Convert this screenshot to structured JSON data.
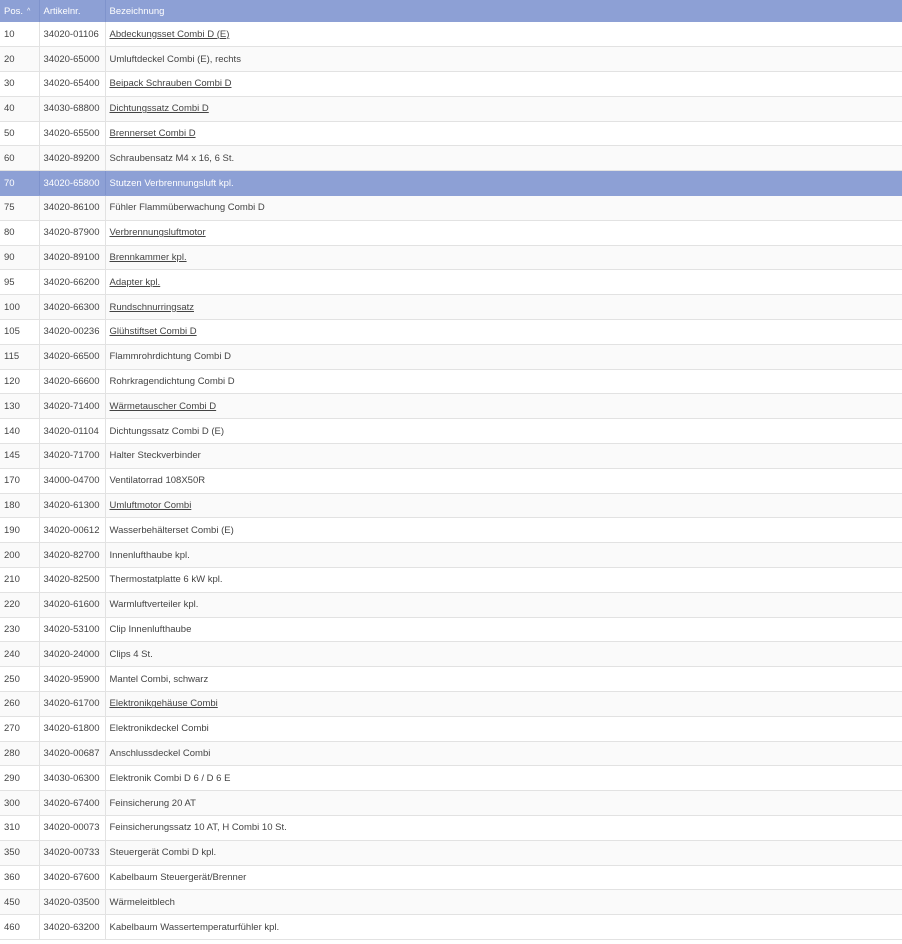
{
  "table": {
    "columns": {
      "pos": "Pos.",
      "artikelnr": "Artikelnr.",
      "bezeichnung": "Bezeichnung"
    },
    "sort_indicator": "^",
    "selected_pos": "70",
    "rows": [
      {
        "pos": "10",
        "artikelnr": "34020-01106",
        "bezeichnung": "Abdeckungsset Combi D (E)",
        "link": true
      },
      {
        "pos": "20",
        "artikelnr": "34020-65000",
        "bezeichnung": "Umluftdeckel Combi (E), rechts",
        "link": false
      },
      {
        "pos": "30",
        "artikelnr": "34020-65400",
        "bezeichnung": "Beipack Schrauben Combi D",
        "link": true
      },
      {
        "pos": "40",
        "artikelnr": "34030-68800",
        "bezeichnung": "Dichtungssatz Combi D",
        "link": true
      },
      {
        "pos": "50",
        "artikelnr": "34020-65500",
        "bezeichnung": "Brennerset Combi D",
        "link": true
      },
      {
        "pos": "60",
        "artikelnr": "34020-89200",
        "bezeichnung": "Schraubensatz M4 x 16, 6 St.",
        "link": false
      },
      {
        "pos": "70",
        "artikelnr": "34020-65800",
        "bezeichnung": "Stutzen Verbrennungsluft kpl.",
        "link": false
      },
      {
        "pos": "75",
        "artikelnr": "34020-86100",
        "bezeichnung": "Fühler Flammüberwachung Combi D",
        "link": false
      },
      {
        "pos": "80",
        "artikelnr": "34020-87900",
        "bezeichnung": "Verbrennungsluftmotor",
        "link": true
      },
      {
        "pos": "90",
        "artikelnr": "34020-89100",
        "bezeichnung": "Brennkammer kpl.",
        "link": true
      },
      {
        "pos": "95",
        "artikelnr": "34020-66200",
        "bezeichnung": "Adapter kpl.",
        "link": true
      },
      {
        "pos": "100",
        "artikelnr": "34020-66300",
        "bezeichnung": "Rundschnurringsatz",
        "link": true
      },
      {
        "pos": "105",
        "artikelnr": "34020-00236",
        "bezeichnung": "Glühstiftset Combi D",
        "link": true
      },
      {
        "pos": "115",
        "artikelnr": "34020-66500",
        "bezeichnung": "Flammrohrdichtung Combi D",
        "link": false
      },
      {
        "pos": "120",
        "artikelnr": "34020-66600",
        "bezeichnung": "Rohrkragendichtung Combi D",
        "link": false
      },
      {
        "pos": "130",
        "artikelnr": "34020-71400",
        "bezeichnung": "Wärmetauscher Combi D",
        "link": true
      },
      {
        "pos": "140",
        "artikelnr": "34020-01104",
        "bezeichnung": "Dichtungssatz Combi D (E)",
        "link": false
      },
      {
        "pos": "145",
        "artikelnr": "34020-71700",
        "bezeichnung": "Halter Steckverbinder",
        "link": false
      },
      {
        "pos": "170",
        "artikelnr": "34000-04700",
        "bezeichnung": "Ventilatorrad 108X50R",
        "link": false
      },
      {
        "pos": "180",
        "artikelnr": "34020-61300",
        "bezeichnung": "Umluftmotor Combi",
        "link": true
      },
      {
        "pos": "190",
        "artikelnr": "34020-00612",
        "bezeichnung": "Wasserbehälterset Combi (E)",
        "link": false
      },
      {
        "pos": "200",
        "artikelnr": "34020-82700",
        "bezeichnung": "Innenlufthaube kpl.",
        "link": false
      },
      {
        "pos": "210",
        "artikelnr": "34020-82500",
        "bezeichnung": "Thermostatplatte 6 kW kpl.",
        "link": false
      },
      {
        "pos": "220",
        "artikelnr": "34020-61600",
        "bezeichnung": "Warmluftverteiler kpl.",
        "link": false
      },
      {
        "pos": "230",
        "artikelnr": "34020-53100",
        "bezeichnung": "Clip Innenlufthaube",
        "link": false
      },
      {
        "pos": "240",
        "artikelnr": "34020-24000",
        "bezeichnung": "Clips 4 St.",
        "link": false
      },
      {
        "pos": "250",
        "artikelnr": "34020-95900",
        "bezeichnung": "Mantel Combi, schwarz",
        "link": false
      },
      {
        "pos": "260",
        "artikelnr": "34020-61700",
        "bezeichnung": "Elektronikgehäuse Combi",
        "link": true
      },
      {
        "pos": "270",
        "artikelnr": "34020-61800",
        "bezeichnung": "Elektronikdeckel Combi",
        "link": false
      },
      {
        "pos": "280",
        "artikelnr": "34020-00687",
        "bezeichnung": "Anschlussdeckel Combi",
        "link": false
      },
      {
        "pos": "290",
        "artikelnr": "34030-06300",
        "bezeichnung": "Elektronik Combi D 6 / D 6 E",
        "link": false
      },
      {
        "pos": "300",
        "artikelnr": "34020-67400",
        "bezeichnung": "Feinsicherung 20 AT",
        "link": false
      },
      {
        "pos": "310",
        "artikelnr": "34020-00073",
        "bezeichnung": "Feinsicherungssatz 10 AT, H Combi 10 St.",
        "link": false
      },
      {
        "pos": "350",
        "artikelnr": "34020-00733",
        "bezeichnung": "Steuergerät Combi D kpl.",
        "link": false
      },
      {
        "pos": "360",
        "artikelnr": "34020-67600",
        "bezeichnung": "Kabelbaum Steuergerät/Brenner",
        "link": false
      },
      {
        "pos": "450",
        "artikelnr": "34020-03500",
        "bezeichnung": "Wärmeleitblech",
        "link": false
      },
      {
        "pos": "460",
        "artikelnr": "34020-63200",
        "bezeichnung": "Kabelbaum Wassertemperaturfühler kpl.",
        "link": false
      }
    ]
  },
  "colors": {
    "header_bg": "#8da0d5",
    "selected_bg": "#8da0d5",
    "text": "#444444",
    "border": "#e2e2e2"
  }
}
